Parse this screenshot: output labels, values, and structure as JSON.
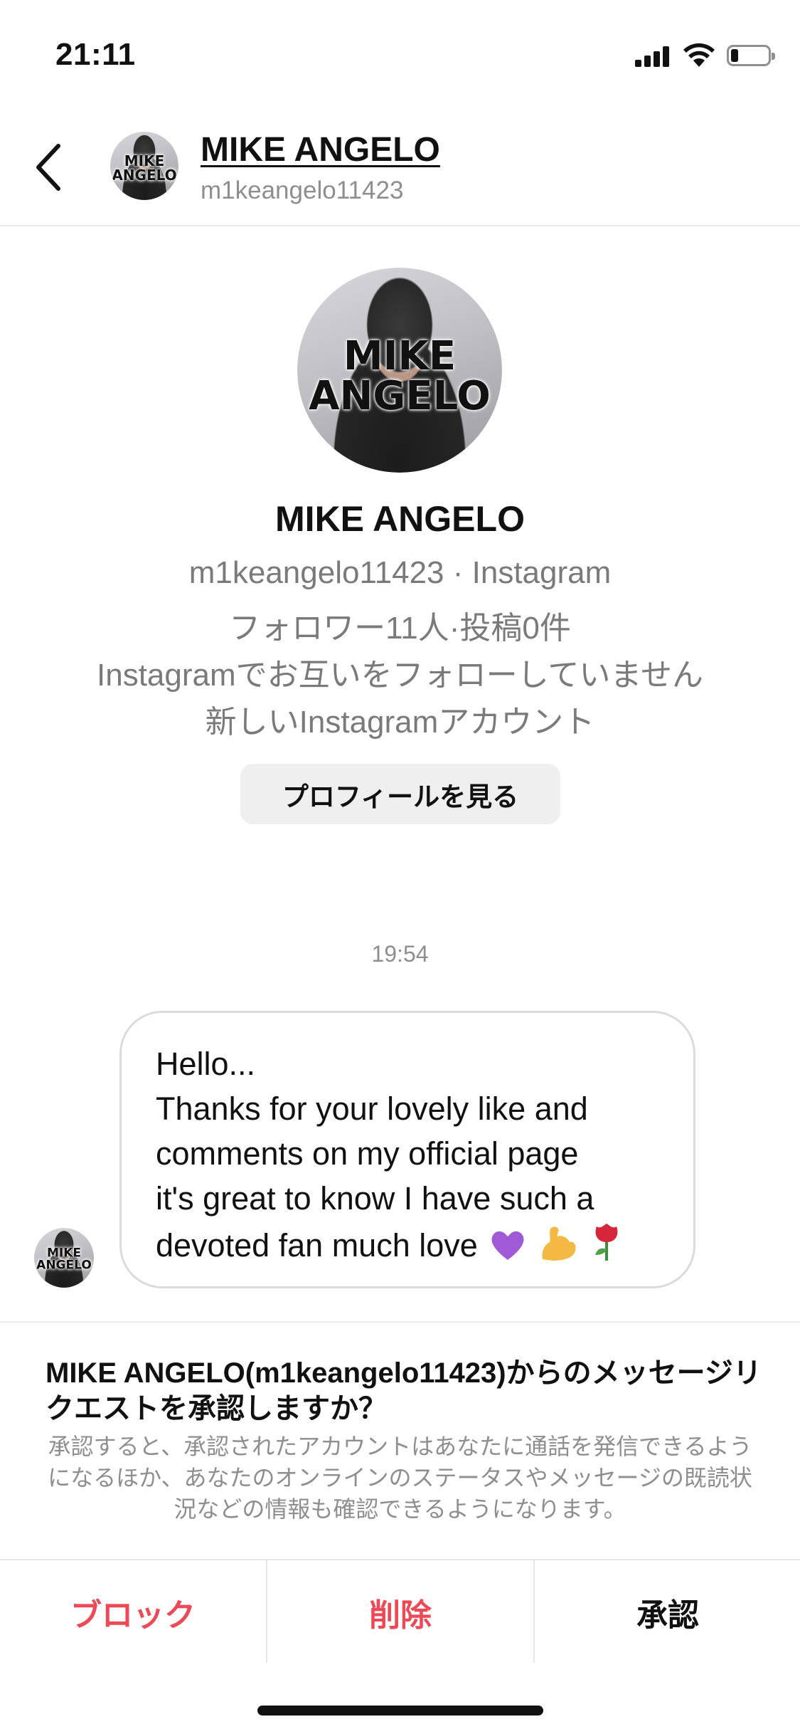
{
  "status_bar": {
    "time": "21:11",
    "battery_level": 0.2
  },
  "header": {
    "name": "MIKE ANGELO",
    "handle": "m1keangelo11423",
    "avatar_text_line1": "MIKE",
    "avatar_text_line2": "ANGELO"
  },
  "profile": {
    "avatar_text_line1": "MIKE",
    "avatar_text_line2": "ANGELO",
    "name": "MIKE ANGELO",
    "handle_line": "m1keangelo11423 · Instagram",
    "stats_line": "フォロワー11人·投稿0件",
    "follow_status": "Instagramでお互いをフォローしていません",
    "account_note": "新しいInstagramアカウント",
    "view_profile_label": "プロフィールを見る"
  },
  "conversation": {
    "timestamp": "19:54",
    "sender_avatar_line1": "MIKE",
    "sender_avatar_line2": "ANGELO",
    "message_lines": [
      "Hello...",
      "Thanks for your lovely like and",
      "comments on my official page",
      "it's great to know I have such a",
      "devoted fan much love"
    ],
    "message_emojis": [
      "purple-heart",
      "flexed-biceps",
      "rose"
    ]
  },
  "request": {
    "title": "MIKE ANGELO(m1keangelo11423)からのメッセージリクエストを承認しますか？",
    "description": "承認すると、承認されたアカウントはあなたに通話を発信できるようになるほか、あなたのオンラインのステータスやメッセージの既読状況などの情報も確認できるようになります。",
    "block_label": "ブロック",
    "delete_label": "削除",
    "accept_label": "承認"
  },
  "colors": {
    "destructive": "#ed4956",
    "secondary_text": "#8e8e8e",
    "button_bg": "#efefef"
  }
}
